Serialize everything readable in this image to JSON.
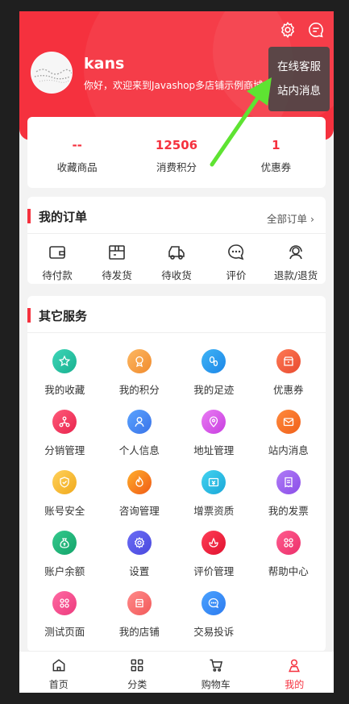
{
  "header": {
    "username": "kans",
    "welcome": "你好，欢迎来到Javashop多店铺示例商城"
  },
  "popup": {
    "items": [
      "在线客服",
      "站内消息"
    ]
  },
  "stats": [
    {
      "value": "--",
      "label": "收藏商品"
    },
    {
      "value": "12506",
      "label": "消费积分"
    },
    {
      "value": "1",
      "label": "优惠券"
    }
  ],
  "orders": {
    "title": "我的订单",
    "more": "全部订单",
    "items": [
      "待付款",
      "待发货",
      "待收货",
      "评价",
      "退款/退货"
    ]
  },
  "services": {
    "title": "其它服务",
    "items": [
      "我的收藏",
      "我的积分",
      "我的足迹",
      "优惠券",
      "分销管理",
      "个人信息",
      "地址管理",
      "站内消息",
      "账号安全",
      "咨询管理",
      "增票资质",
      "我的发票",
      "账户余额",
      "设置",
      "评价管理",
      "帮助中心",
      "测试页面",
      "我的店铺",
      "交易投诉"
    ]
  },
  "tabs": [
    "首页",
    "分类",
    "购物车",
    "我的"
  ],
  "colors": {
    "brand": "#f5313e",
    "annotation_arrow": "#5ee332"
  }
}
